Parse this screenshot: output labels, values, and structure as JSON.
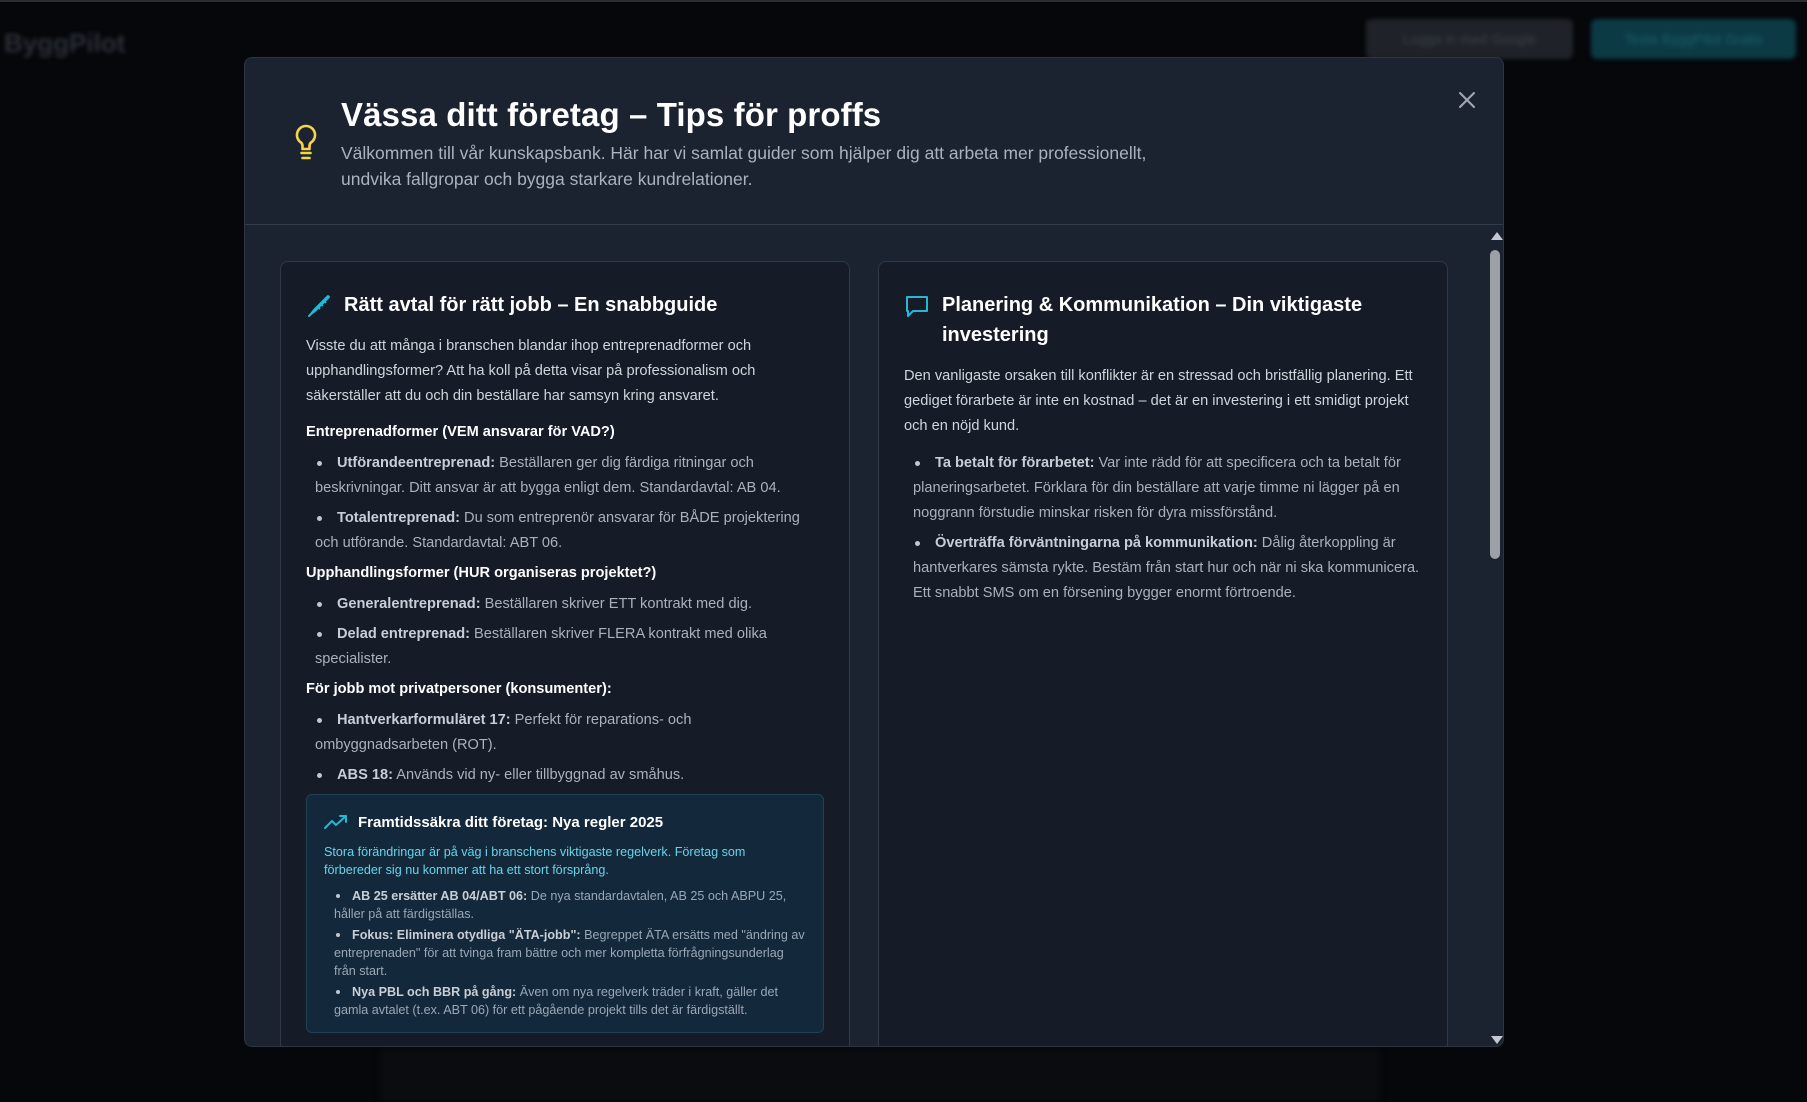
{
  "background": {
    "logo": "ByggPilot",
    "login_button": "Logga in med Google",
    "cta_button": "Testa ByggPilot Gratis"
  },
  "modal": {
    "icon": "lightbulb-icon",
    "title": "Vässa ditt företag – Tips för proffs",
    "subtitle": "Välkommen till vår kunskapsbank. Här har vi samlat guider som hjälper dig att arbeta mer professionellt, undvika fallgropar och bygga starkare kundrelationer.",
    "close_icon": "close-icon"
  },
  "left_card": {
    "icon": "pen-icon",
    "title": "Rätt avtal för rätt jobb – En snabbguide",
    "intro": "Visste du att många i branschen blandar ihop entreprenadformer och upphandlingsformer? Att ha koll på detta visar på professionalism och säkerställer att du och din beställare har samsyn kring ansvaret.",
    "sections": [
      {
        "heading": "Entreprenadformer (VEM ansvarar för VAD?)",
        "items": [
          {
            "term": "Utförandeentreprenad:",
            "text": " Beställaren ger dig färdiga ritningar och beskrivningar. Ditt ansvar är att bygga enligt dem. Standardavtal: AB 04."
          },
          {
            "term": "Totalentreprenad:",
            "text": " Du som entreprenör ansvarar för BÅDE projektering och utförande. Standardavtal: ABT 06."
          }
        ]
      },
      {
        "heading": "Upphandlingsformer (HUR organiseras projektet?)",
        "items": [
          {
            "term": "Generalentreprenad:",
            "text": " Beställaren skriver ETT kontrakt med dig."
          },
          {
            "term": "Delad entreprenad:",
            "text": " Beställaren skriver FLERA kontrakt med olika specialister."
          }
        ]
      },
      {
        "heading": "För jobb mot privatpersoner (konsumenter):",
        "items": [
          {
            "term": "Hantverkarformuläret 17:",
            "text": " Perfekt för reparations- och ombyggnadsarbeten (ROT)."
          },
          {
            "term": "ABS 18:",
            "text": " Används vid ny- eller tillbyggnad av småhus."
          }
        ]
      }
    ],
    "future": {
      "icon": "trending-up-icon",
      "title": "Framtidssäkra ditt företag: Nya regler 2025",
      "intro": "Stora förändringar är på väg i branschens viktigaste regelverk. Företag som förbereder sig nu kommer att ha ett stort försprång.",
      "items": [
        {
          "term": "AB 25 ersätter AB 04/ABT 06:",
          "text": " De nya standardavtalen, AB 25 och ABPU 25, håller på att färdigställas."
        },
        {
          "term": "Fokus: Eliminera otydliga \"ÄTA-jobb\":",
          "text": " Begreppet ÄTA ersätts med \"ändring av entreprenaden\" för att tvinga fram bättre och mer kompletta förfrågningsunderlag från start."
        },
        {
          "term": "Nya PBL och BBR på gång:",
          "text": " Även om nya regelverk träder i kraft, gäller det gamla avtalet (t.ex. ABT 06) för ett pågående projekt tills det är färdigställt."
        }
      ]
    }
  },
  "right_card": {
    "icon": "chat-icon",
    "title": "Planering & Kommunikation – Din viktigaste investering",
    "intro": "Den vanligaste orsaken till konflikter är en stressad och bristfällig planering. Ett gediget förarbete är inte en kostnad – det är en investering i ett smidigt projekt och en nöjd kund.",
    "items": [
      {
        "term": "Ta betalt för förarbetet:",
        "text": " Var inte rädd för att specificera och ta betalt för planeringsarbetet. Förklara för din beställare att varje timme ni lägger på en noggrann förstudie minskar risken för dyra missförstånd."
      },
      {
        "term": "Överträffa förväntningarna på kommunikation:",
        "text": " Dålig återkoppling är hantverkares sämsta rykte. Bestäm från start hur och när ni ska kommunicera. Ett snabbt SMS om en försening bygger enormt förtroende."
      }
    ]
  },
  "colors": {
    "accent_cyan": "#22b8d6",
    "bulb_yellow": "#f5d547",
    "modal_bg": "#1c2330",
    "card_bg": "#151c28"
  }
}
